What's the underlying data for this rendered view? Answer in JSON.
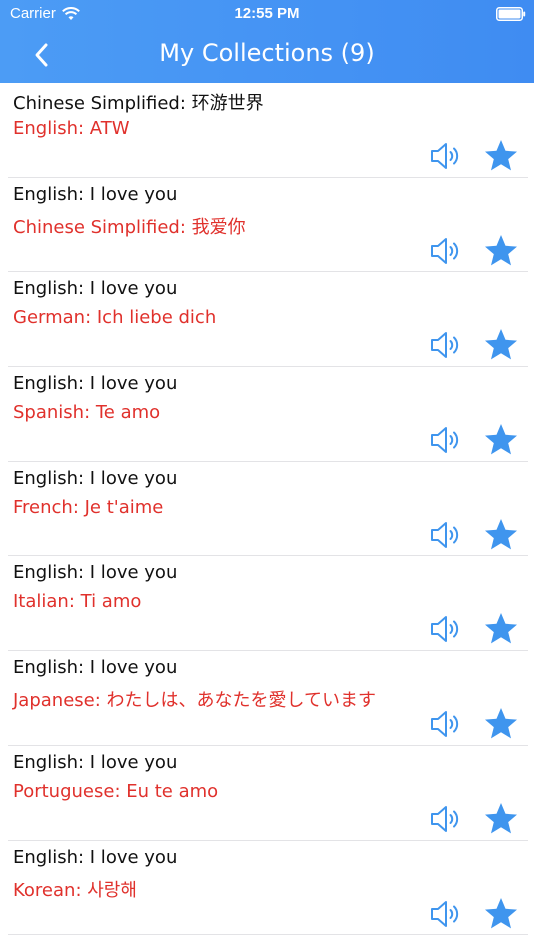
{
  "status_bar": {
    "carrier": "Carrier",
    "time": "12:55 PM"
  },
  "header": {
    "title": "My Collections (9)",
    "color": "#4c9cf5"
  },
  "icons": {
    "back": "chevron-left-icon",
    "speaker": "speaker-icon",
    "favorite": "star-icon"
  },
  "colors": {
    "translation": "#e0312c",
    "icon_blue": "#3f95ee"
  },
  "items": [
    {
      "source": "Chinese Simplified: 环游世界",
      "target": "English: ATW"
    },
    {
      "source": "English: I love you",
      "target": "Chinese Simplified: 我爱你"
    },
    {
      "source": "English: I love you",
      "target": "German: Ich liebe dich"
    },
    {
      "source": "English: I love you",
      "target": "Spanish: Te amo"
    },
    {
      "source": "English: I love you",
      "target": "French: Je t'aime"
    },
    {
      "source": "English: I love you",
      "target": "Italian: Ti amo"
    },
    {
      "source": "English: I love you",
      "target": "Japanese: わたしは、あなたを愛しています"
    },
    {
      "source": "English: I love you",
      "target": "Portuguese: Eu te amo"
    },
    {
      "source": "English: I love you",
      "target": "Korean: 사랑해"
    }
  ]
}
